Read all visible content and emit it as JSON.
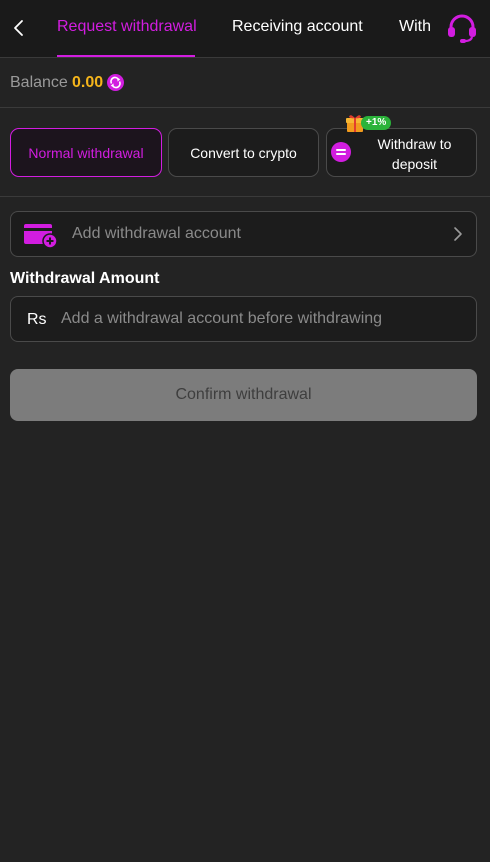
{
  "header": {
    "tabs": [
      {
        "label": "Request withdrawal",
        "active": true
      },
      {
        "label": "Receiving account",
        "active": false
      },
      {
        "label": "With",
        "active": false
      }
    ]
  },
  "balance": {
    "label": "Balance",
    "value": "0.00"
  },
  "methods": {
    "normal": "Normal withdrawal",
    "crypto": "Convert to crypto",
    "deposit": "Withdraw to deposit",
    "bonus_badge": "+1%"
  },
  "account": {
    "add_label": "Add withdrawal account"
  },
  "amount": {
    "title": "Withdrawal Amount",
    "currency": "Rs",
    "placeholder": "Add a withdrawal account before withdrawing"
  },
  "confirm_label": "Confirm withdrawal",
  "colors": {
    "accent": "#d21de0",
    "balance": "#f5b51b",
    "background": "#232323",
    "bonus": "#2bb33a"
  },
  "icons": [
    "back-arrow-icon",
    "headset-icon",
    "refresh-icon",
    "deposit-icon",
    "gift-icon",
    "card-add-icon",
    "chevron-right-icon"
  ]
}
